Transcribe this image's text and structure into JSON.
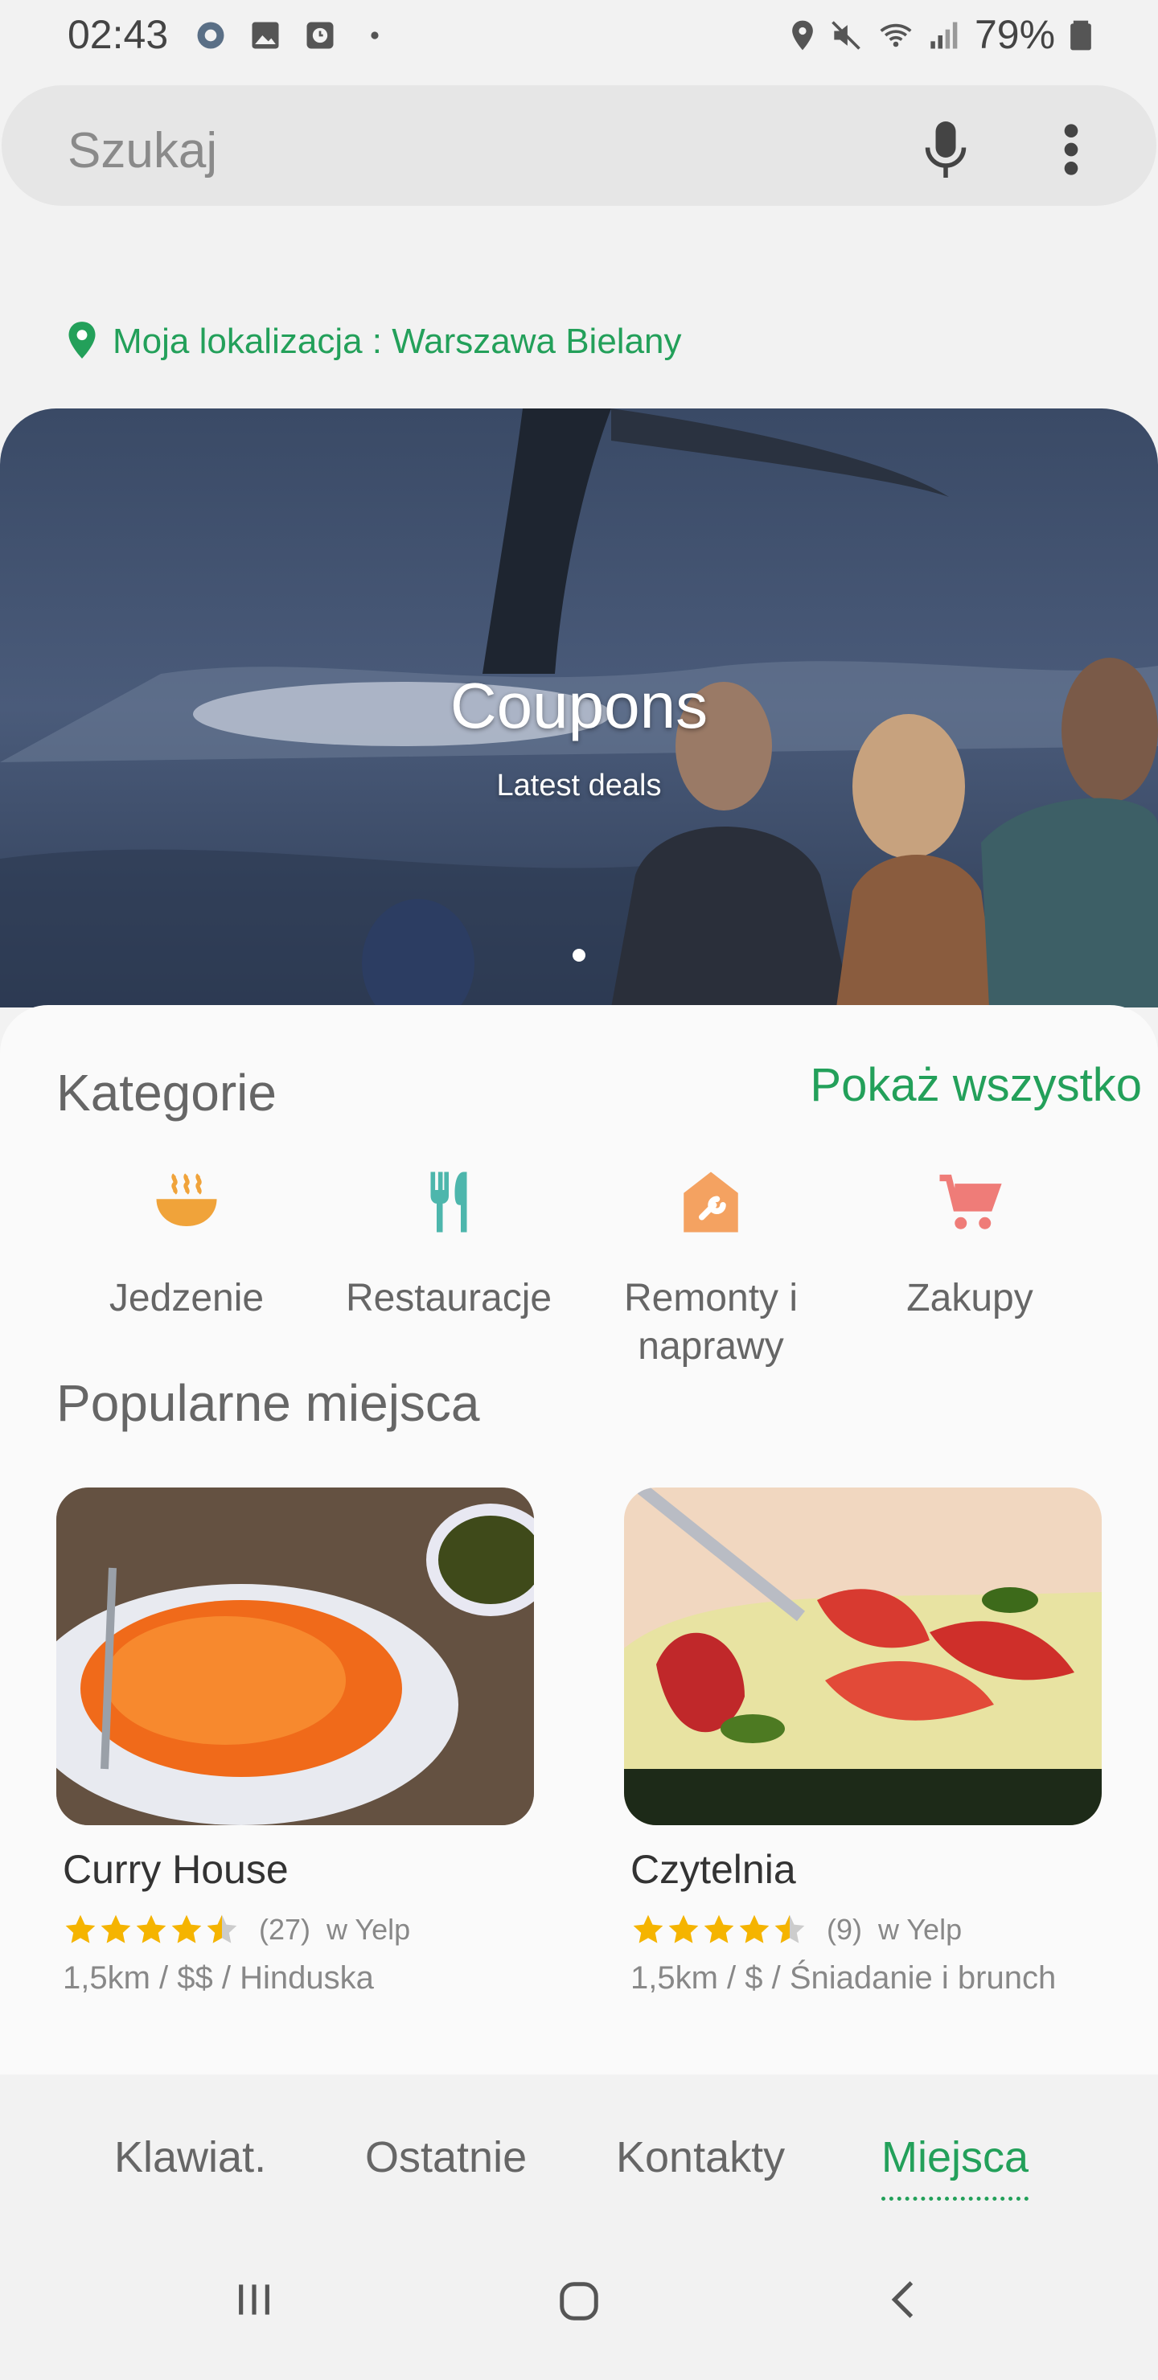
{
  "status_bar": {
    "time": "02:43",
    "battery": "79%",
    "icons": [
      "gear-icon",
      "image-icon",
      "clock-icon",
      "dot-icon",
      "location-icon",
      "mute-icon",
      "wifi-icon",
      "signal-icon",
      "battery-icon"
    ]
  },
  "search": {
    "placeholder": "Szukaj"
  },
  "location": {
    "label": "Moja lokalizacja : Warszawa Bielany"
  },
  "banner": {
    "title": "Coupons",
    "subtitle": "Latest deals"
  },
  "categories": {
    "title": "Kategorie",
    "show_all": "Pokaż wszystko",
    "items": [
      {
        "label": "Jedzenie",
        "icon": "food-bowl-icon",
        "color": "#f0a33a"
      },
      {
        "label": "Restauracje",
        "icon": "cutlery-icon",
        "color": "#4db6ac"
      },
      {
        "label": "Remonty i naprawy",
        "icon": "house-wrench-icon",
        "color": "#f4a261"
      },
      {
        "label": "Zakupy",
        "icon": "cart-icon",
        "color": "#ef7c78"
      }
    ]
  },
  "popular": {
    "title": "Popularne miejsca",
    "places": [
      {
        "name": "Curry House",
        "rating": 4.5,
        "count": "(27)",
        "source": "w Yelp",
        "meta": "1,5km / $$ / Hinduska"
      },
      {
        "name": "Czytelnia",
        "rating": 4.5,
        "count": "(9)",
        "source": "w Yelp",
        "meta": "1,5km / $ / Śniadanie i brunch"
      }
    ]
  },
  "tabs": {
    "items": [
      "Klawiat.",
      "Ostatnie",
      "Kontakty",
      "Miejsca"
    ],
    "active": "Miejsca"
  },
  "colors": {
    "accent": "#23a05a",
    "star": "#f5b400"
  }
}
